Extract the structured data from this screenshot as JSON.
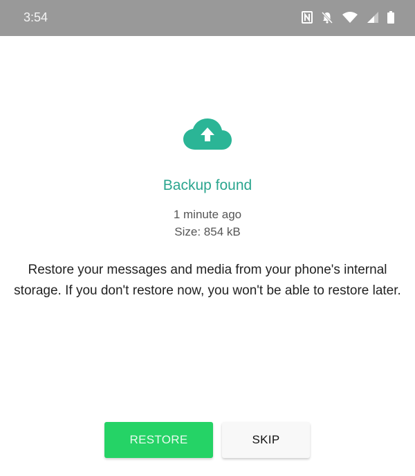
{
  "status_bar": {
    "time": "3:54",
    "icons": [
      "nfc-icon",
      "notifications-off-icon",
      "wifi-icon",
      "cellular-signal-icon",
      "battery-icon"
    ]
  },
  "main": {
    "icon": "cloud-upload-icon",
    "title": "Backup found",
    "backup_time": "1 minute ago",
    "backup_size": "Size: 854 kB",
    "description": "Restore your messages and media from your phone's internal storage. If you don't restore now, you won't be able to restore later."
  },
  "actions": {
    "restore_label": "RESTORE",
    "skip_label": "SKIP"
  },
  "colors": {
    "accent": "#2aa58e",
    "primary_button": "#25d366",
    "status_bar": "#999999"
  }
}
